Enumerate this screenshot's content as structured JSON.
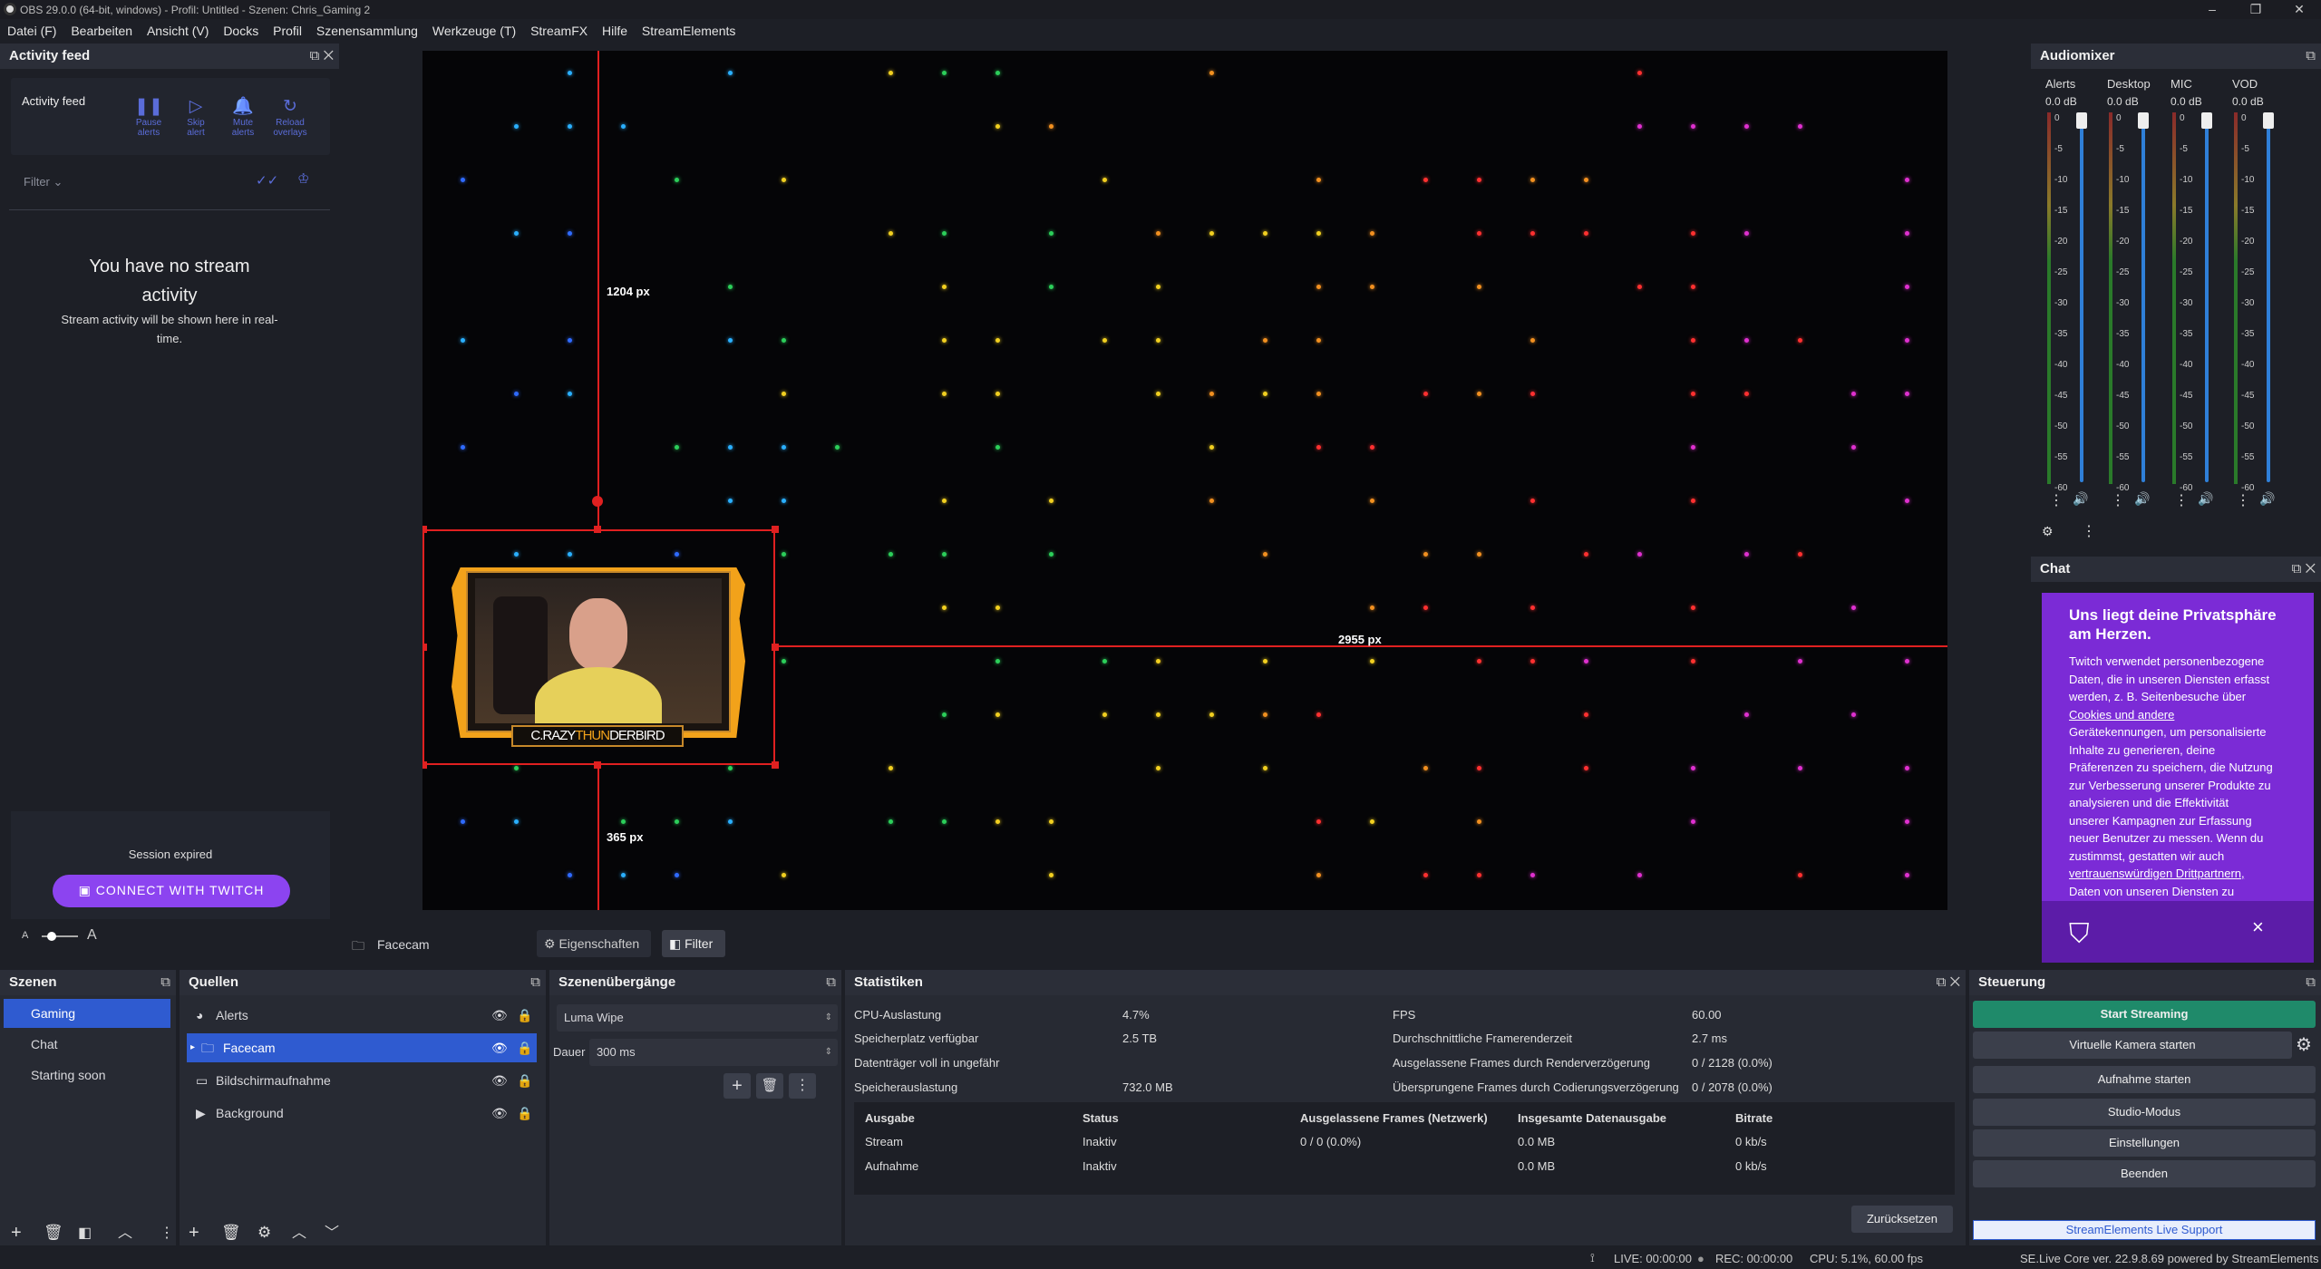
{
  "window": {
    "title": "OBS 29.0.0 (64-bit, windows) - Profil: Untitled - Szenen: Chris_Gaming 2",
    "minimize": "–",
    "maximize": "❐",
    "close": "✕"
  },
  "menu": [
    "Datei (F)",
    "Bearbeiten",
    "Ansicht (V)",
    "Docks",
    "Profil",
    "Szenensammlung",
    "Werkzeuge (T)",
    "StreamFX",
    "Hilfe",
    "StreamElements"
  ],
  "activity_feed": {
    "title": "Activity feed",
    "card_title": "Activity feed",
    "buttons": [
      {
        "label1": "Pause",
        "label2": "alerts",
        "icon": "pause-icon",
        "glyph": "❚❚"
      },
      {
        "label1": "Skip",
        "label2": "alert",
        "icon": "skip-icon",
        "glyph": "▷"
      },
      {
        "label1": "Mute",
        "label2": "alerts",
        "icon": "bell-icon",
        "glyph": "🔔"
      },
      {
        "label1": "Reload",
        "label2": "overlays",
        "icon": "reload-icon",
        "glyph": "↻"
      }
    ],
    "filter_label": "Filter",
    "empty_title_1": "You have no stream",
    "empty_title_2": "activity",
    "empty_sub_1": "Stream activity will be shown here in real-",
    "empty_sub_2": "time.",
    "session": "Session expired",
    "connect_button": "CONNECT WITH TWITCH",
    "font_small": "A",
    "font_large": "A"
  },
  "preview": {
    "measure_top": "1204 px",
    "measure_right": "2955 px",
    "measure_bottom": "365 px",
    "facecam_logo_left": "C.RAZY",
    "facecam_logo_mid": "THUN",
    "facecam_logo_right": "DERBIRD"
  },
  "source_toolbar": {
    "source_name": "Facecam",
    "properties": "Eigenschaften",
    "filters": "Filter"
  },
  "audio_mixer": {
    "title": "Audiomixer",
    "channels": [
      {
        "name": "Alerts",
        "db": "0.0 dB"
      },
      {
        "name": "Desktop",
        "db": "0.0 dB"
      },
      {
        "name": "MIC",
        "db": "0.0 dB"
      },
      {
        "name": "VOD",
        "db": "0.0 dB"
      }
    ],
    "scale": [
      "0",
      "-5",
      "-10",
      "-15",
      "-20",
      "-25",
      "-30",
      "-35",
      "-40",
      "-45",
      "-50",
      "-55",
      "-60"
    ]
  },
  "chat": {
    "title": "Chat",
    "heading": "Uns liegt deine Privatsphäre am Herzen.",
    "lines": [
      "Twitch verwendet personenbezogene",
      "Daten, die in unseren Diensten erfasst",
      "werden, z. B. Seitenbesuche über",
      "Cookies und andere",
      "Gerätekennungen, um personalisierte",
      "Inhalte zu generieren, deine",
      "Präferenzen zu speichern, die Nutzung",
      "zur Verbesserung unserer Produkte zu",
      "analysieren und die Effektivität",
      "unserer Kampagnen zur Erfassung",
      "neuer Benutzer zu messen.  Wenn du",
      "zustimmst, gestatten wir auch",
      "vertrauenswürdigen Drittpartnern,",
      "Daten von unseren Diensten zu"
    ],
    "close": "×"
  },
  "scenes": {
    "title": "Szenen",
    "items": [
      "Gaming",
      "Chat",
      "Starting soon"
    ]
  },
  "sources": {
    "title": "Quellen",
    "items": [
      {
        "name": "Alerts",
        "icon": "browser-icon"
      },
      {
        "name": "Facecam",
        "icon": "folder-icon"
      },
      {
        "name": "Bildschirmaufnahme",
        "icon": "monitor-icon"
      },
      {
        "name": "Background",
        "icon": "play-icon"
      }
    ]
  },
  "transitions": {
    "title": "Szenenübergänge",
    "selected": "Luma Wipe",
    "duration_label": "Dauer",
    "duration_value": "300 ms"
  },
  "stats": {
    "title": "Statistiken",
    "left": [
      {
        "label": "CPU-Auslastung",
        "value": "4.7%"
      },
      {
        "label": "Speicherplatz verfügbar",
        "value": "2.5 TB"
      },
      {
        "label": "Datenträger voll in ungefähr",
        "value": ""
      },
      {
        "label": "Speicherauslastung",
        "value": "732.0 MB"
      }
    ],
    "right": [
      {
        "label": "FPS",
        "value": "60.00"
      },
      {
        "label": "Durchschnittliche Framerenderzeit",
        "value": "2.7 ms"
      },
      {
        "label": "Ausgelassene Frames durch Renderverzögerung",
        "value": "0 / 2128 (0.0%)"
      },
      {
        "label": "Übersprungene Frames durch Codierungsverzögerung",
        "value": "0 / 2078 (0.0%)"
      }
    ],
    "table_headers": [
      "Ausgabe",
      "Status",
      "Ausgelassene Frames (Netzwerk)",
      "Insgesamte Datenausgabe",
      "Bitrate"
    ],
    "table_rows": [
      [
        "Stream",
        "Inaktiv",
        "0 / 0 (0.0%)",
        "0.0 MB",
        "0 kb/s"
      ],
      [
        "Aufnahme",
        "Inaktiv",
        "",
        "0.0 MB",
        "0 kb/s"
      ]
    ],
    "reset": "Zurücksetzen"
  },
  "controls": {
    "title": "Steuerung",
    "start_streaming": "Start Streaming",
    "virtual_cam": "Virtuelle Kamera starten",
    "start_recording": "Aufnahme starten",
    "studio_mode": "Studio-Modus",
    "settings": "Einstellungen",
    "exit": "Beenden",
    "support": "StreamElements Live Support"
  },
  "statusbar": {
    "live": "LIVE: 00:00:00",
    "rec": "REC: 00:00:00",
    "cpu": "CPU: 5.1%, 60.00 fps",
    "version": "SE.Live Core ver. 22.9.8.69 powered by StreamElements"
  },
  "colors": {
    "accent_blue": "#2f5bd0",
    "twitch_purple": "#7b2bd6",
    "start_green": "#1f8a6a",
    "selection_red": "#e02020",
    "facecam_orange": "#f2a21a"
  }
}
